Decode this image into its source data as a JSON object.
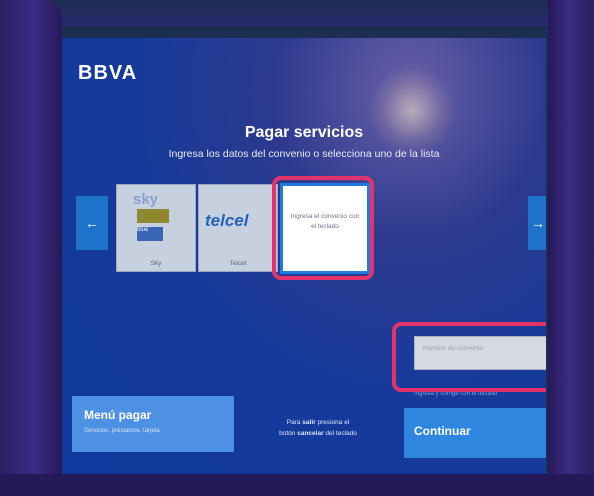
{
  "brand": {
    "logo": "BBVA"
  },
  "header": {
    "title": "Pagar servicios",
    "subtitle": "Ingresa los datos del convenio o selecciona uno de la lista"
  },
  "carousel": {
    "prev_icon": "←",
    "next_icon": "→",
    "cards": [
      {
        "logo_top": "sky",
        "logo_blue": "blue",
        "label": "Sky"
      },
      {
        "logo": "telcel",
        "label": "Telcel"
      }
    ],
    "input_card_text": "Ingresa el convenio con el teclado"
  },
  "convenio": {
    "placeholder": "Número de convenio",
    "hint": "Ingresa y corrige con el teclado"
  },
  "menu_pagar": {
    "title": "Menú pagar",
    "subtitle": "Servicios, préstamos, tarjeta"
  },
  "exit_instructions": {
    "line1_pre": "Para ",
    "line1_bold": "salir",
    "line1_post": " presiona el",
    "line2_pre": "botón ",
    "line2_bold": "cancelar",
    "line2_post": " del teclado"
  },
  "continuar": {
    "label": "Continuar"
  },
  "colors": {
    "highlight": "#e2336b",
    "accent": "#2e86df"
  }
}
